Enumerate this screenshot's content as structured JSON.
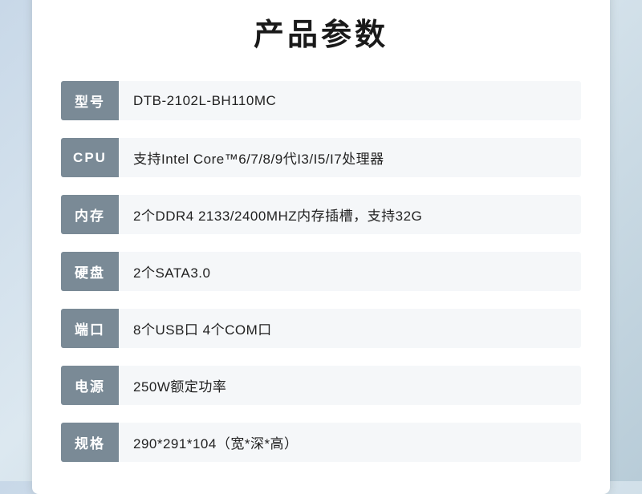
{
  "title": "产品参数",
  "specs": [
    {
      "label": "型号",
      "value": "DTB-2102L-BH110MC"
    },
    {
      "label": "CPU",
      "value": "支持Intel Core™6/7/8/9代I3/I5/I7处理器"
    },
    {
      "label": "内存",
      "value": "2个DDR4 2133/2400MHZ内存插槽，支持32G"
    },
    {
      "label": "硬盘",
      "value": "2个SATA3.0"
    },
    {
      "label": "端口",
      "value": "8个USB口 4个COM口"
    },
    {
      "label": "电源",
      "value": "250W额定功率"
    },
    {
      "label": "规格",
      "value": "290*291*104（宽*深*高）"
    }
  ]
}
